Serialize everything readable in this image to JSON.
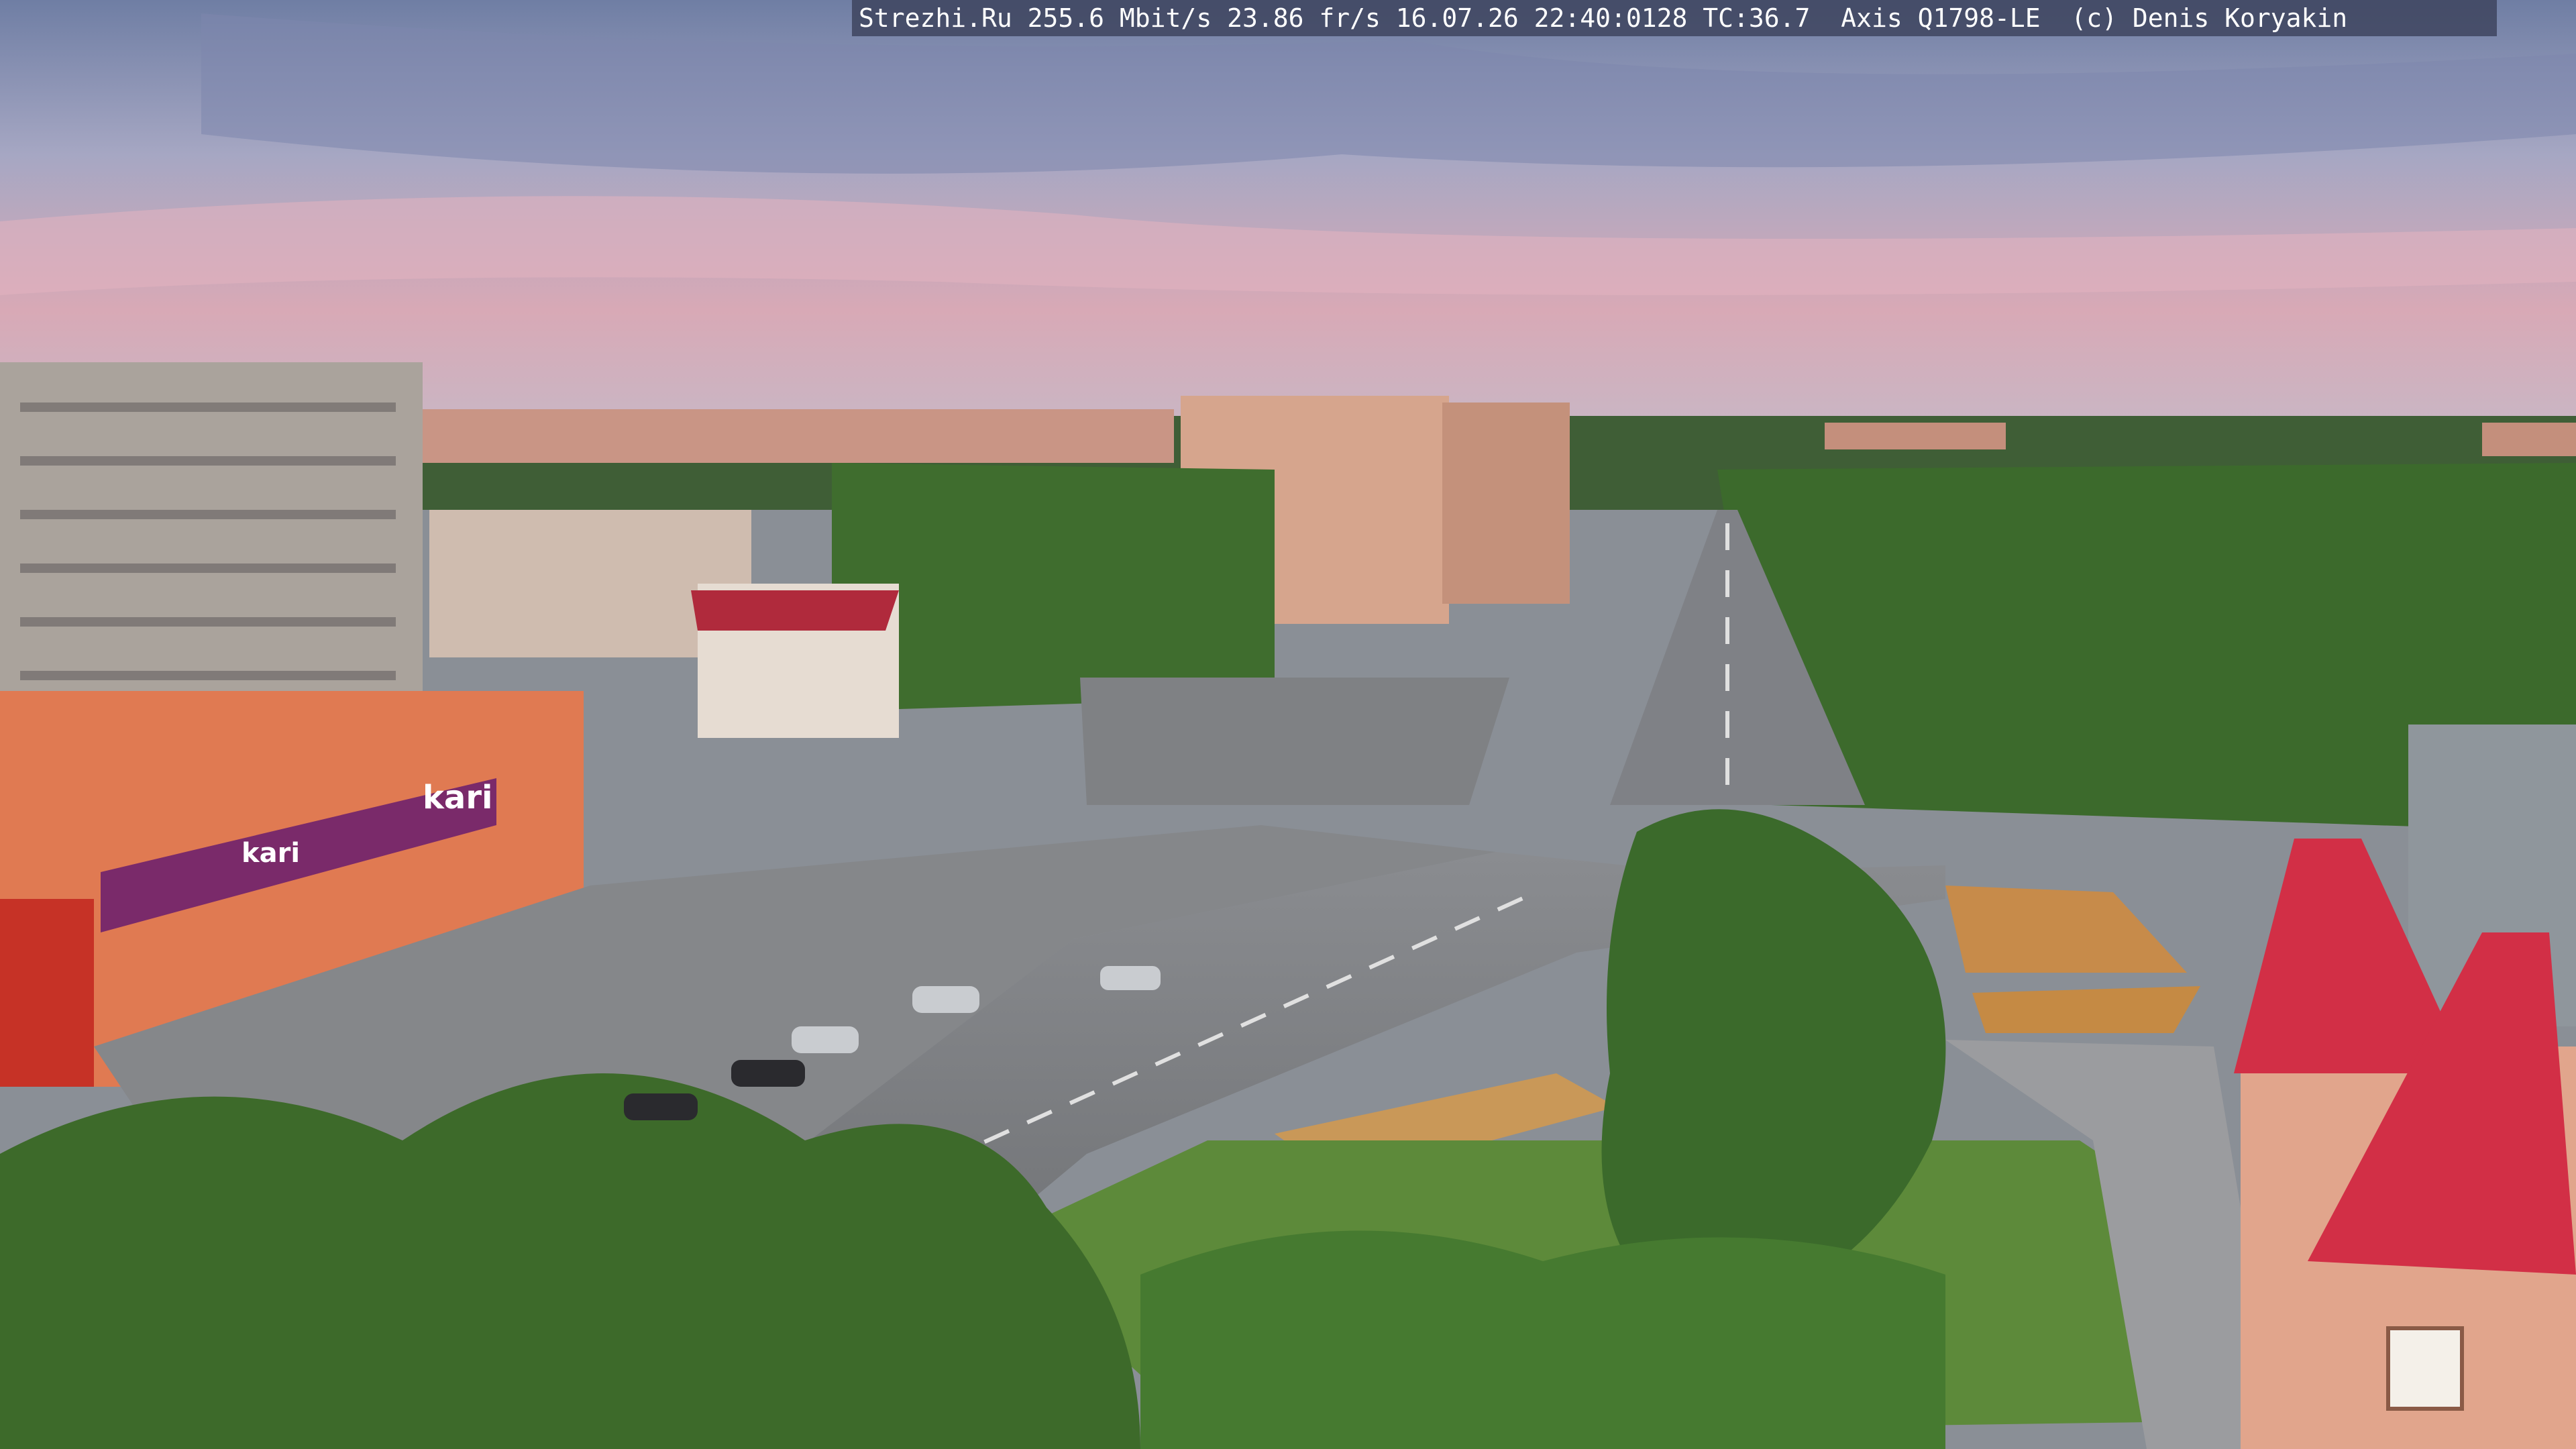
{
  "overlay": {
    "text": "Strezhi.Ru 255.6 Mbit/s 23.86 fr/s 16.07.26 22:40:0128 TC:36.7  Axis Q1798-LE  (c) Denis Koryakin"
  },
  "signs": {
    "kari_roof": "kari",
    "kari_facade": "kari"
  },
  "colors": {
    "sky_top": "#6f7ea4",
    "sky_pink": "#d8a9b6",
    "trees": "#3f6b2c",
    "road": "#7b7d80",
    "roof_red": "#d22f46"
  }
}
